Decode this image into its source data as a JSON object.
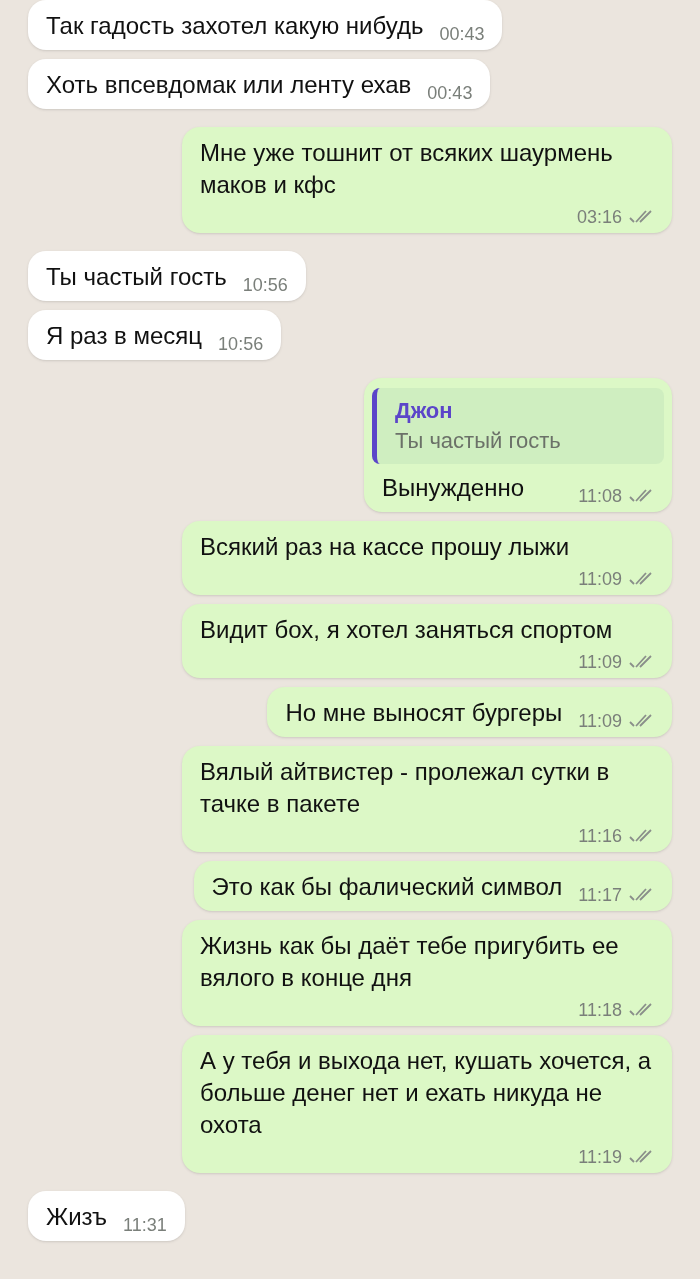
{
  "messages": [
    {
      "kind": "incoming",
      "text": "Так гадость захотел какую нибудь",
      "time": "00:43"
    },
    {
      "kind": "incoming",
      "text": "Хоть впсевдомак или ленту ехав",
      "time": "00:43"
    },
    {
      "kind": "outgoing",
      "text": "Мне уже тошнит от всяких шаурмень маков и кфс",
      "time": "03:16",
      "read": false
    },
    {
      "kind": "incoming",
      "text": "Ты частый гость",
      "time": "10:56"
    },
    {
      "kind": "incoming",
      "text": "Я раз в месяц",
      "time": "10:56"
    },
    {
      "kind": "outgoing",
      "text": "Вынужденно",
      "time": "11:08",
      "read": false,
      "reply": {
        "author": "Джон",
        "text": "Ты частый гость"
      }
    },
    {
      "kind": "outgoing",
      "text": "Всякий раз на кассе прошу лыжи",
      "time": "11:09",
      "read": false
    },
    {
      "kind": "outgoing",
      "text": "Видит бох, я хотел заняться спортом",
      "time": "11:09",
      "read": false
    },
    {
      "kind": "outgoing",
      "text": "Но мне выносят бургеры",
      "time": "11:09",
      "read": false
    },
    {
      "kind": "outgoing",
      "text": "Вялый айтвистер - пролежал сутки в тачке в пакете",
      "time": "11:16",
      "read": false
    },
    {
      "kind": "outgoing",
      "text": "Это как бы фалический символ",
      "time": "11:17",
      "read": false
    },
    {
      "kind": "outgoing",
      "text": "Жизнь как бы даёт тебе пригубить ее вялого в конце дня",
      "time": "11:18",
      "read": false
    },
    {
      "kind": "outgoing",
      "text": "А у тебя и выхода нет, кушать хочется, а больше денег нет и ехать никуда не охота",
      "time": "11:19",
      "read": false
    },
    {
      "kind": "incoming",
      "text": "Жизъ",
      "time": "11:31"
    }
  ]
}
